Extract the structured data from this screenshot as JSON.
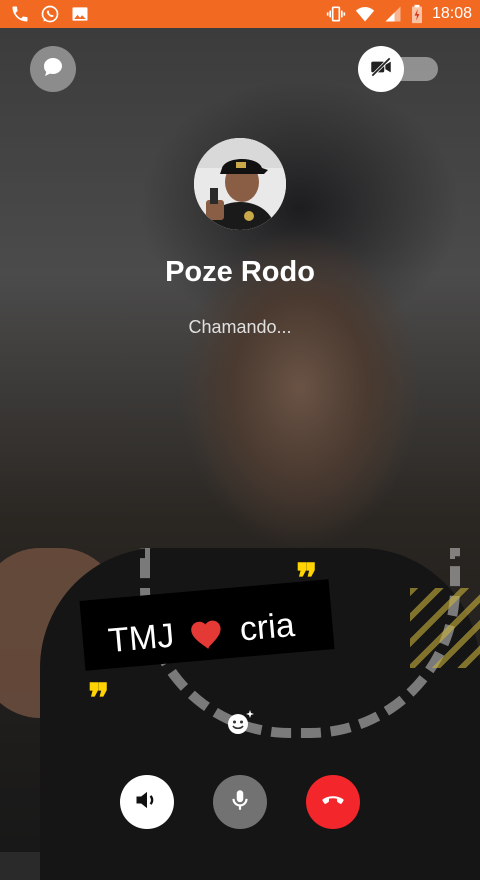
{
  "status_bar": {
    "time": "18:08",
    "left_icons": [
      "phone-icon",
      "whatsapp-icon",
      "image-icon"
    ],
    "right_icons": [
      "vibrate-icon",
      "wifi-icon",
      "signal-icon",
      "battery-charging-icon"
    ],
    "background_color": "#f26a22"
  },
  "call": {
    "caller_name": "Poze Rodo",
    "status": "Chamando..."
  },
  "sticker": {
    "text_left": "TMJ",
    "text_right": "cria",
    "heart_color": "#e53935",
    "quote_color": "#ffd400"
  },
  "controls": {
    "top_left": "chat-icon",
    "top_right": "video-off-icon",
    "bottom": [
      "speaker-icon",
      "microphone-icon",
      "end-call-icon"
    ],
    "end_call_color": "#f2262b"
  }
}
